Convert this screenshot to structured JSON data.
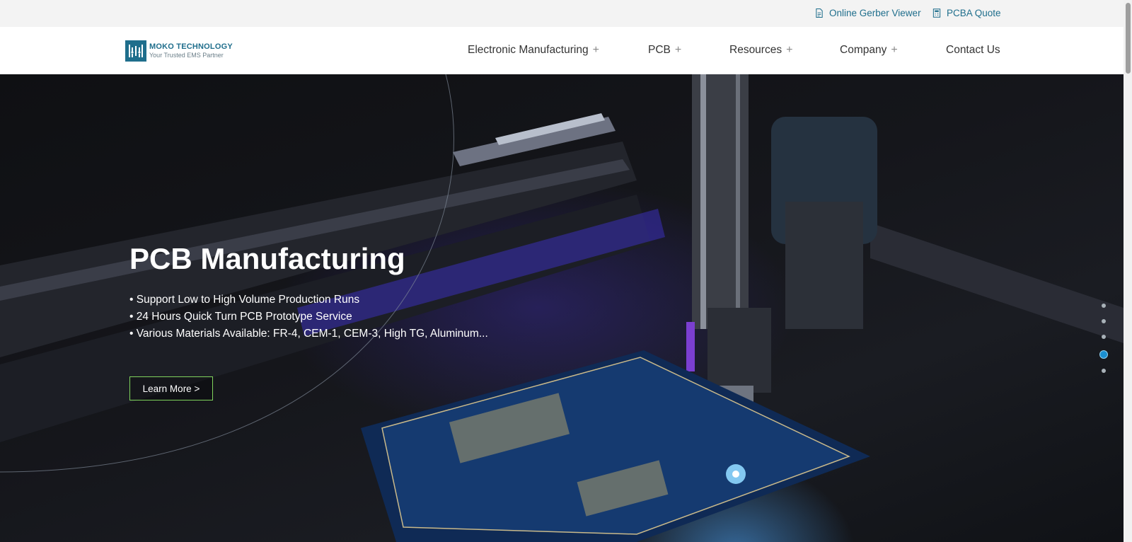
{
  "topbar": {
    "gerber_label": "Online Gerber Viewer",
    "gerber_icon": "document-icon",
    "pcba_label": "PCBA Quote",
    "pcba_icon": "calculator-icon"
  },
  "logo": {
    "name": "MOKO TECHNOLOGY",
    "tagline": "Your Trusted EMS Partner"
  },
  "nav": {
    "items": [
      {
        "label": "Electronic Manufacturing",
        "expand": "+"
      },
      {
        "label": "PCB",
        "expand": "+"
      },
      {
        "label": "Resources",
        "expand": "+"
      },
      {
        "label": "Company",
        "expand": "+"
      },
      {
        "label": "Contact Us"
      }
    ]
  },
  "hero": {
    "title": "PCB Manufacturing",
    "bullets": [
      "• Support Low to High Volume Production Runs",
      "• 24 Hours Quick Turn PCB Prototype Service",
      "• Various Materials Available: FR-4, CEM-1, CEM-3, High TG, Aluminum..."
    ],
    "cta_label": "Learn More >",
    "slide_count": 5,
    "active_slide": 4
  },
  "colors": {
    "brand": "#1f6e8c",
    "cta_border": "#7fd35c",
    "active_dot": "#1b8fd0"
  }
}
